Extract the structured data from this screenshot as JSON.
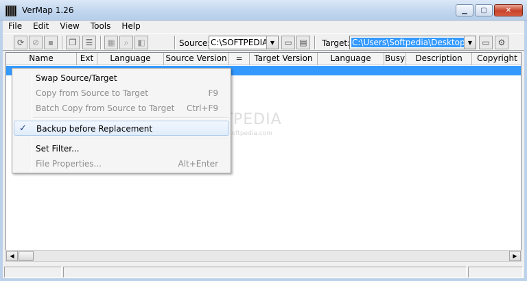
{
  "window": {
    "title": "VerMap 1.26",
    "close_glyph": "✕",
    "minimize_glyph": "▁",
    "maximize_glyph": "▢"
  },
  "menu": [
    "File",
    "Edit",
    "View",
    "Tools",
    "Help"
  ],
  "toolbar": {
    "source_label": "Source:",
    "source_value": "C:\\SOFTPEDIA\\",
    "target_label": "Target:",
    "target_value": "C:\\Users\\Softpedia\\Desktop\\"
  },
  "columns": [
    "Name",
    "Ext",
    "Language",
    "Source Version",
    "=",
    "Target Version",
    "Language",
    "Busy",
    "Description",
    "Copyright"
  ],
  "context_menu": {
    "items": [
      {
        "label": "Swap Source/Target",
        "shortcut": "",
        "enabled": true
      },
      {
        "label": "Copy from Source to Target",
        "shortcut": "F9",
        "enabled": false
      },
      {
        "label": "Batch Copy from Source to Target",
        "shortcut": "Ctrl+F9",
        "enabled": false
      },
      {
        "label": "Backup before Replacement",
        "shortcut": "",
        "enabled": true,
        "checked": true
      },
      {
        "label": "Set Filter...",
        "shortcut": "",
        "enabled": true
      },
      {
        "label": "File Properties...",
        "shortcut": "Alt+Enter",
        "enabled": false
      }
    ],
    "check_glyph": "✓"
  },
  "watermark": {
    "text": "SOFTPEDIA",
    "sub": "www.softpedia.com"
  },
  "colors": {
    "selection": "#3399ff",
    "titlebar": "#c4d8ef",
    "close": "#c7432b"
  }
}
